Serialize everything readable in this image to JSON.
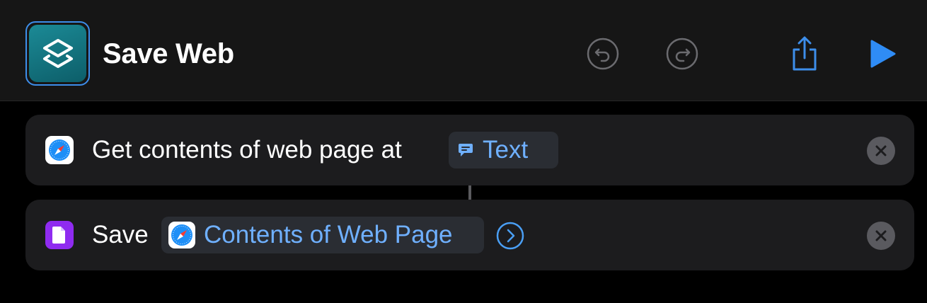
{
  "header": {
    "title": "Save Web",
    "app_icon": "shortcuts-layers-icon",
    "accent_color": "#3d8eea",
    "buttons": {
      "undo": "undo-icon",
      "redo": "redo-icon",
      "share": "share-icon",
      "run": "play-icon"
    }
  },
  "actions": [
    {
      "app_icon": "safari-compass-icon",
      "label": "Get contents of web page at",
      "variable": {
        "icon": "text-bubble-icon",
        "label": "Text"
      },
      "remove_icon": "close-icon"
    },
    {
      "app_icon": "files-document-icon",
      "label": "Save",
      "variable": {
        "icon": "safari-compass-icon",
        "label": "Contents of Web Page"
      },
      "expand_icon": "chevron-right-circle-icon",
      "remove_icon": "close-icon"
    }
  ],
  "colors": {
    "background": "#000000",
    "card": "#1c1c1e",
    "token_text": "#6fb0ff",
    "files_purple": "#8f2bf0",
    "run_blue": "#2f8cf5"
  }
}
